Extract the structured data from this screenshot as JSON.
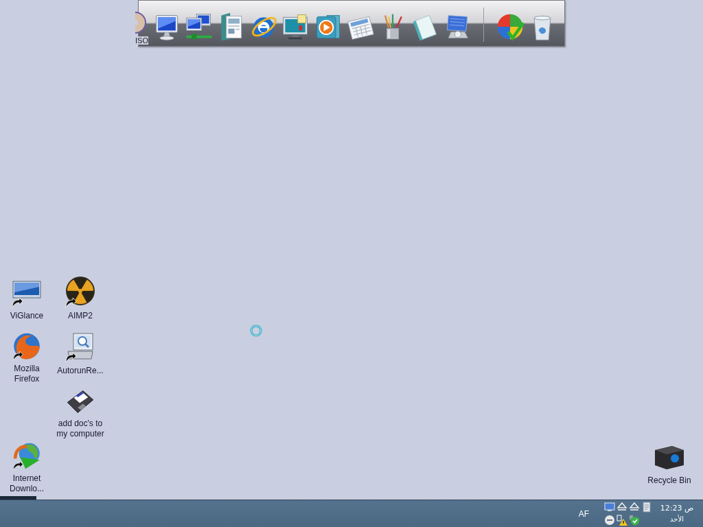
{
  "dock": {
    "first_item_label": "ISO"
  },
  "desktop_icons": [
    {
      "label": "ViGlance",
      "kind": "monitor"
    },
    {
      "label": "AIMP2",
      "kind": "disc"
    },
    {
      "label": "Mozilla Firefox",
      "kind": "flame_globe"
    },
    {
      "label": "AutorunRe...",
      "kind": "computer"
    },
    {
      "label": "add doc's to my computer",
      "kind": "floppy"
    },
    {
      "label": "Internet Downlo...",
      "kind": "download_globe"
    }
  ],
  "recycle_bin": {
    "label": "Recycle Bin"
  },
  "taskbar": {
    "language": "AF",
    "clock": {
      "time": "12:23 ص",
      "day": "الأحد"
    }
  }
}
